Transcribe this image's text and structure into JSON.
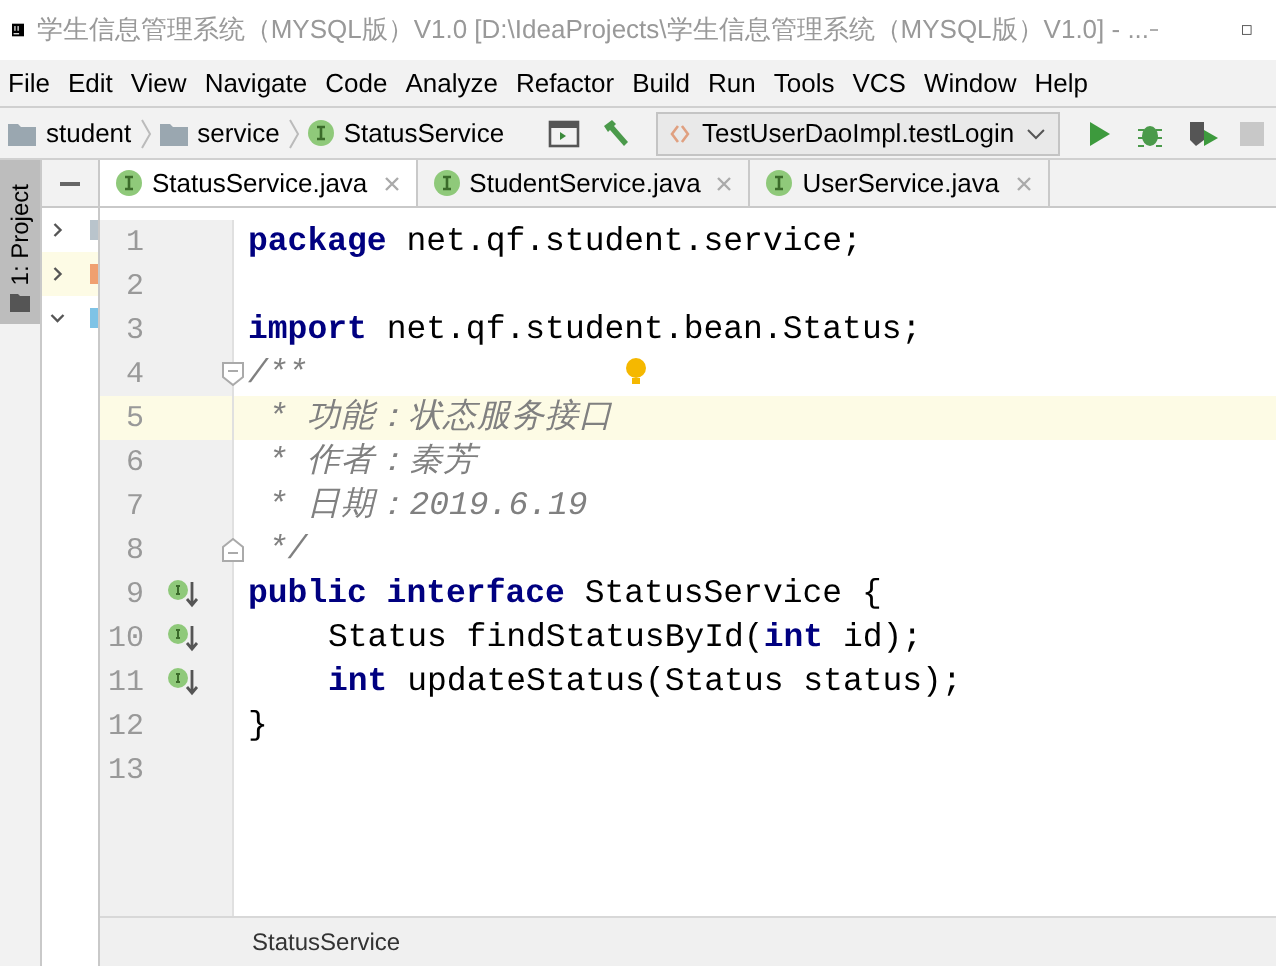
{
  "window": {
    "title": "学生信息管理系统（MYSQL版）V1.0 [D:\\IdeaProjects\\学生信息管理系统（MYSQL版）V1.0] - ..."
  },
  "menu": [
    "File",
    "Edit",
    "View",
    "Navigate",
    "Code",
    "Analyze",
    "Refactor",
    "Build",
    "Run",
    "Tools",
    "VCS",
    "Window",
    "Help"
  ],
  "breadcrumbs": [
    {
      "label": "student",
      "kind": "folder"
    },
    {
      "label": "service",
      "kind": "folder"
    },
    {
      "label": "StatusService",
      "kind": "interface"
    }
  ],
  "run_config": "TestUserDaoImpl.testLogin",
  "tool_window": {
    "label": "1: Project"
  },
  "project_tree": [
    {
      "expanded": false,
      "selected": false,
      "color": "#b9c4cc"
    },
    {
      "expanded": false,
      "selected": true,
      "color": "#f0a070"
    },
    {
      "expanded": true,
      "selected": false,
      "color": "#7ec3e6"
    }
  ],
  "tabs": [
    {
      "label": "StatusService.java",
      "selected": true
    },
    {
      "label": "StudentService.java",
      "selected": false
    },
    {
      "label": "UserService.java",
      "selected": false
    }
  ],
  "lines": [
    {
      "number": "1",
      "current": false,
      "tokens": [
        {
          "kind": "keyword",
          "text": "package"
        },
        {
          "kind": "plain",
          "text": " net.qf.student.service;"
        }
      ]
    },
    {
      "number": "2",
      "current": false
    },
    {
      "number": "3",
      "current": false,
      "tokens": [
        {
          "kind": "keyword",
          "text": "import"
        },
        {
          "kind": "plain",
          "text": " net.qf.student.bean.Status;"
        }
      ]
    },
    {
      "number": "4",
      "current": false,
      "fold_start": true,
      "bulb": true,
      "tokens": [
        {
          "kind": "comment",
          "text": "/**"
        }
      ]
    },
    {
      "number": "5",
      "current": true,
      "tokens": [
        {
          "kind": "comment",
          "text": " * 功能：状态服务接口"
        }
      ]
    },
    {
      "number": "6",
      "current": false,
      "tokens": [
        {
          "kind": "comment",
          "text": " * 作者：秦芳"
        }
      ]
    },
    {
      "number": "7",
      "current": false,
      "tokens": [
        {
          "kind": "comment",
          "text": " * 日期：2019.6.19"
        }
      ]
    },
    {
      "number": "8",
      "current": false,
      "fold_end": true,
      "tokens": [
        {
          "kind": "comment",
          "text": " */"
        }
      ]
    },
    {
      "number": "9",
      "current": false,
      "marker": true,
      "tokens": [
        {
          "kind": "keyword",
          "text": "public interface"
        },
        {
          "kind": "plain",
          "text": " StatusService {"
        }
      ]
    },
    {
      "number": "10",
      "current": false,
      "marker": true,
      "indented": true,
      "tokens": [
        {
          "kind": "plain",
          "text": "Status findStatusById("
        },
        {
          "kind": "keyword",
          "text": "int"
        },
        {
          "kind": "plain",
          "text": " id);"
        }
      ]
    },
    {
      "number": "11",
      "current": false,
      "marker": true,
      "indented": true,
      "tokens": [
        {
          "kind": "keyword",
          "text": "int"
        },
        {
          "kind": "plain",
          "text": " updateStatus(Status status);"
        }
      ]
    },
    {
      "number": "12",
      "current": false,
      "tokens": [
        {
          "kind": "plain",
          "text": "}"
        }
      ]
    },
    {
      "number": "13",
      "current": false
    }
  ],
  "status_breadcrumb": "StatusService"
}
